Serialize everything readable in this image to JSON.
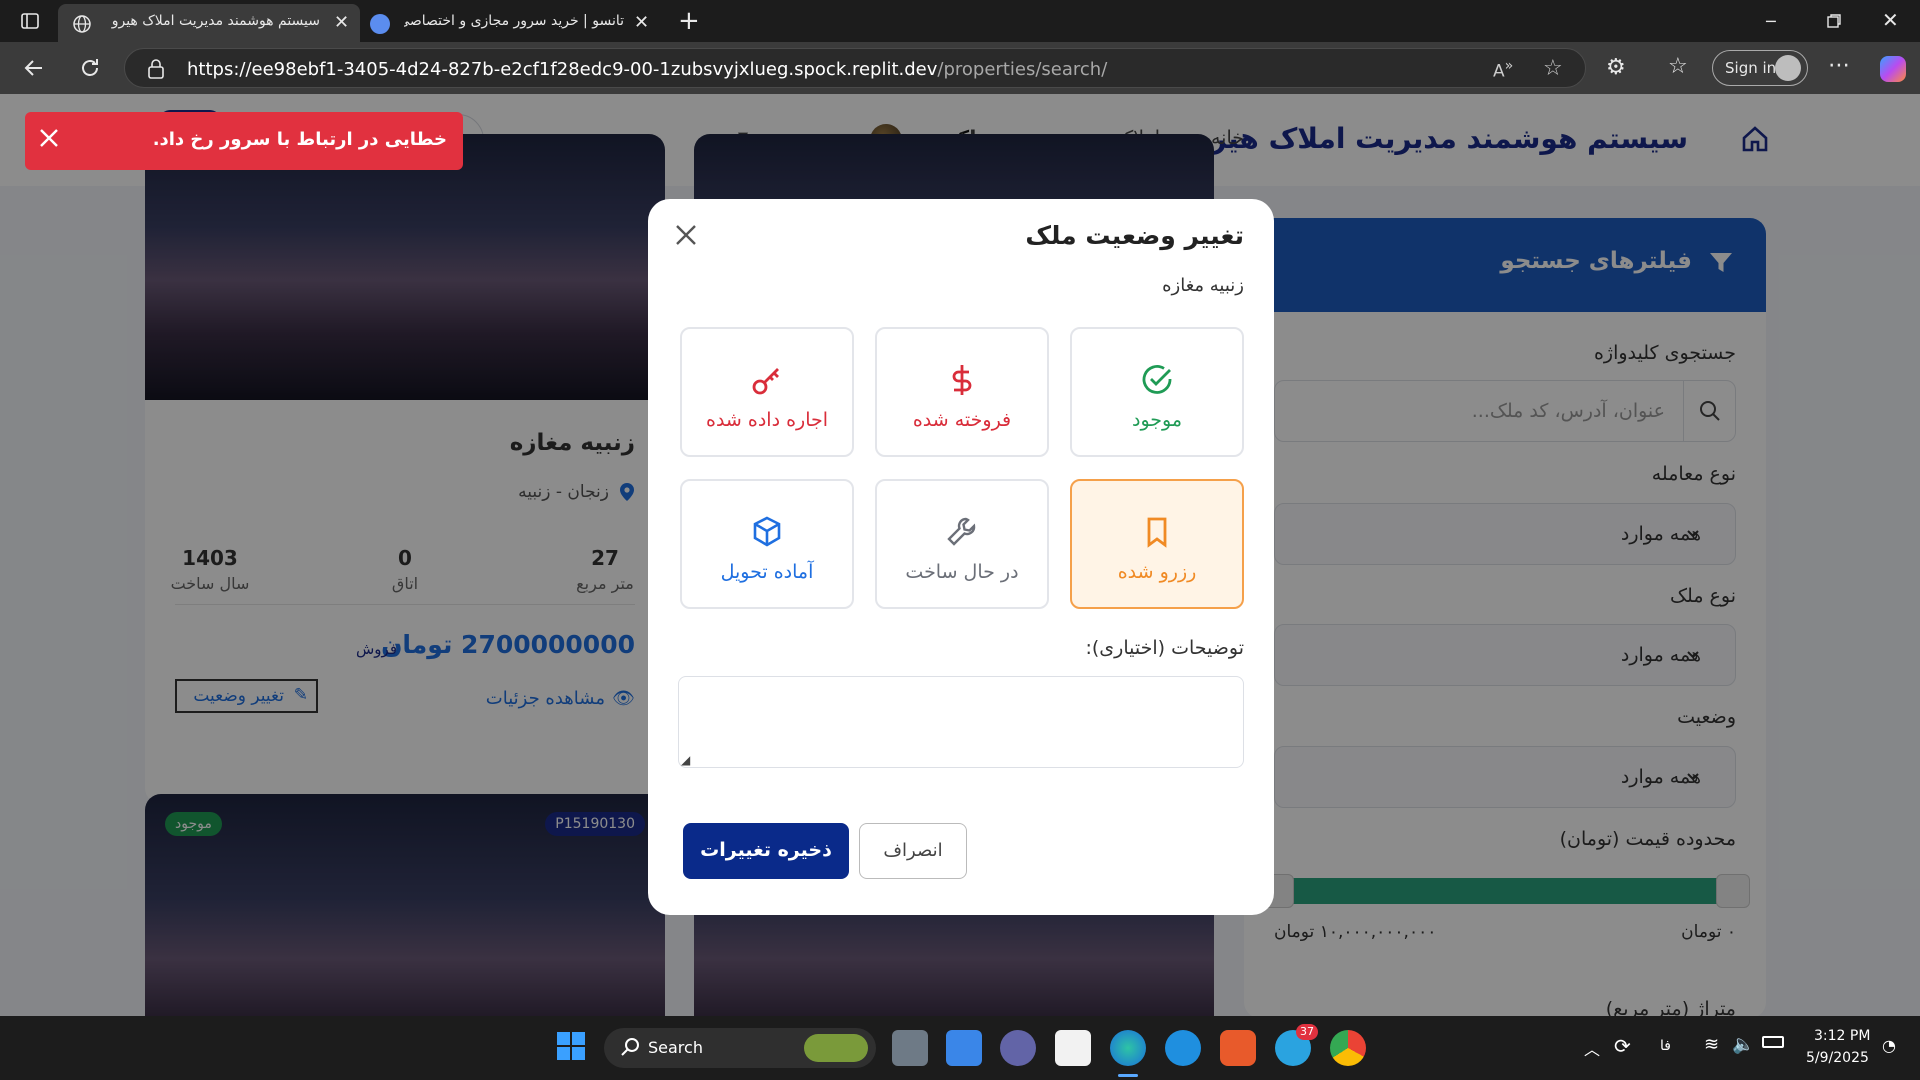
{
  "browser": {
    "tabs": [
      {
        "title": "سیستم هوشمند مدیریت املاک هیرو",
        "active": true
      },
      {
        "title": "تانسو | خرید سرور مجازی و اختصاصی",
        "active": false
      }
    ],
    "url_main": "https://ee98ebf1-3405-4d24-827b-e2cf1f28edc9-00-1zubsvyjxlueg.spock.replit.dev",
    "url_path": "/properties/search/",
    "sign_in": "Sign in"
  },
  "nav": {
    "brand": "سیستم هوشمند مدیریت املاک هیرو",
    "links": [
      "خانه",
      "املاک",
      "جستجوی ملک",
      "داشبورد"
    ],
    "user": "مدیر سیستم"
  },
  "toast": {
    "message": "خطایی در ارتباط با سرور رخ داد."
  },
  "filters": {
    "title": "فیلترهای جستجو",
    "keyword_label": "جستجوی کلیدواژه",
    "keyword_placeholder": "عنوان، آدرس، کد ملک...",
    "deal_type_label": "نوع معامله",
    "deal_type_value": "همه موارد",
    "property_type_label": "نوع ملک",
    "property_type_value": "همه موارد",
    "status_label": "وضعیت",
    "status_value": "همه موارد",
    "price_label": "محدوده قیمت (تومان)",
    "price_min": "۰ تومان",
    "price_max": "۱۰,۰۰۰,۰۰۰,۰۰۰ تومان",
    "area_label": "متراژ (متر مربع)"
  },
  "card": {
    "title": "زنبیه مغازه",
    "location": "زنجان - زنبیه",
    "stats": [
      {
        "value": "27",
        "label": "متر مربع"
      },
      {
        "value": "0",
        "label": "اتاق"
      },
      {
        "value": "1403",
        "label": "سال ساخت"
      }
    ],
    "price": "2700000000 تومان",
    "deal": "فروش",
    "details": "مشاهده جزئیات",
    "change_status": "تغییر وضعیت"
  },
  "card2": {
    "code": "P15190130",
    "badge": "موجود"
  },
  "modal": {
    "title": "تغییر وضعیت ملک",
    "subtitle": "زنبیه مغازه",
    "options": [
      {
        "label": "موجود",
        "color": "#1f9b55",
        "icon": "check-circle-icon"
      },
      {
        "label": "فروخته شده",
        "color": "#d92d3a",
        "icon": "dollar-icon"
      },
      {
        "label": "اجاره داده شده",
        "color": "#d92d3a",
        "icon": "key-icon"
      },
      {
        "label": "رزرو شده",
        "color": "#f08a24",
        "icon": "bookmark-icon",
        "selected": true
      },
      {
        "label": "در حال ساخت",
        "color": "#6b6f78",
        "icon": "wrench-icon"
      },
      {
        "label": "آماده تحویل",
        "color": "#1f6fe0",
        "icon": "box-icon"
      }
    ],
    "notes_label": "توضیحات (اختیاری):",
    "save": "ذخیره تغییرات",
    "cancel": "انصراف"
  },
  "taskbar": {
    "search": "Search",
    "time": "3:12 PM",
    "date": "5/9/2025",
    "lang": "فا",
    "badge": "37"
  }
}
